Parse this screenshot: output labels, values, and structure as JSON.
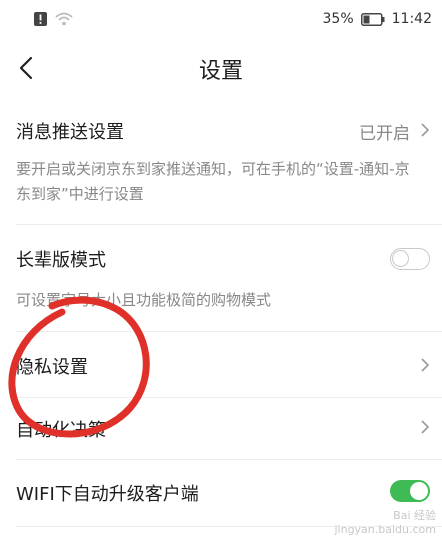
{
  "status_bar": {
    "battery": "35%",
    "time": "11:42"
  },
  "header": {
    "title": "设置"
  },
  "settings": {
    "push": {
      "label": "消息推送设置",
      "value": "已开启",
      "desc": "要开启或关闭京东到家推送通知，可在手机的“设置-通知-京东到家”中进行设置"
    },
    "elder_mode": {
      "label": "长辈版模式",
      "enabled": false,
      "desc": "可设置字号大小且功能极简的购物模式"
    },
    "privacy": {
      "label": "隐私设置"
    },
    "auto_decision": {
      "label": "自动化决策"
    },
    "wifi_update": {
      "label": "WIFI下自动升级客户端",
      "enabled": true
    }
  },
  "colors": {
    "toggle_on": "#3fbb55",
    "annotation_circle": "#e0302a"
  },
  "watermark": {
    "line1": "Bai 经验",
    "line2": "jingyan.baidu.com"
  }
}
